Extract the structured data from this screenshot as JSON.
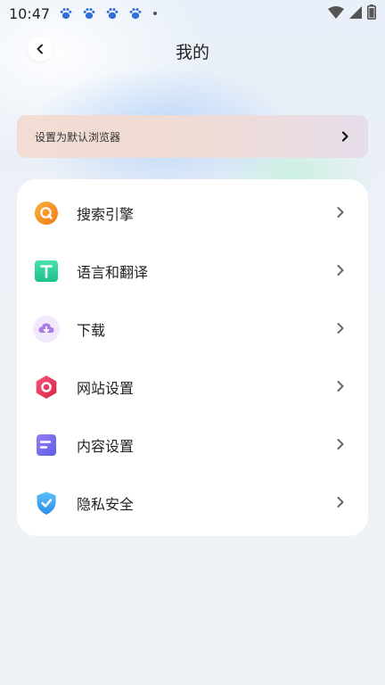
{
  "status_bar": {
    "time": "10:47",
    "notification_icons": [
      "baidu-paw-icon",
      "baidu-paw-icon",
      "baidu-paw-icon",
      "baidu-paw-icon"
    ],
    "right_icons": [
      "wifi-icon",
      "signal-icon",
      "battery-icon"
    ]
  },
  "header": {
    "title": "我的",
    "back_icon": "chevron-left-icon"
  },
  "default_browser": {
    "label": "设置为默认浏览器",
    "icon": "chevron-right-icon"
  },
  "menu": {
    "items": [
      {
        "label": "搜索引擎",
        "icon": "search-engine-icon",
        "color": "#f59a2a"
      },
      {
        "label": "语言和翻译",
        "icon": "translate-icon",
        "color": "#2fd3a0"
      },
      {
        "label": "下载",
        "icon": "download-icon",
        "color": "#a97be8"
      },
      {
        "label": "网站设置",
        "icon": "website-settings-icon",
        "color": "#ea3d5c"
      },
      {
        "label": "内容设置",
        "icon": "content-settings-icon",
        "color": "#7a6cf0"
      },
      {
        "label": "隐私安全",
        "icon": "privacy-shield-icon",
        "color": "#3aa6f2"
      }
    ]
  }
}
